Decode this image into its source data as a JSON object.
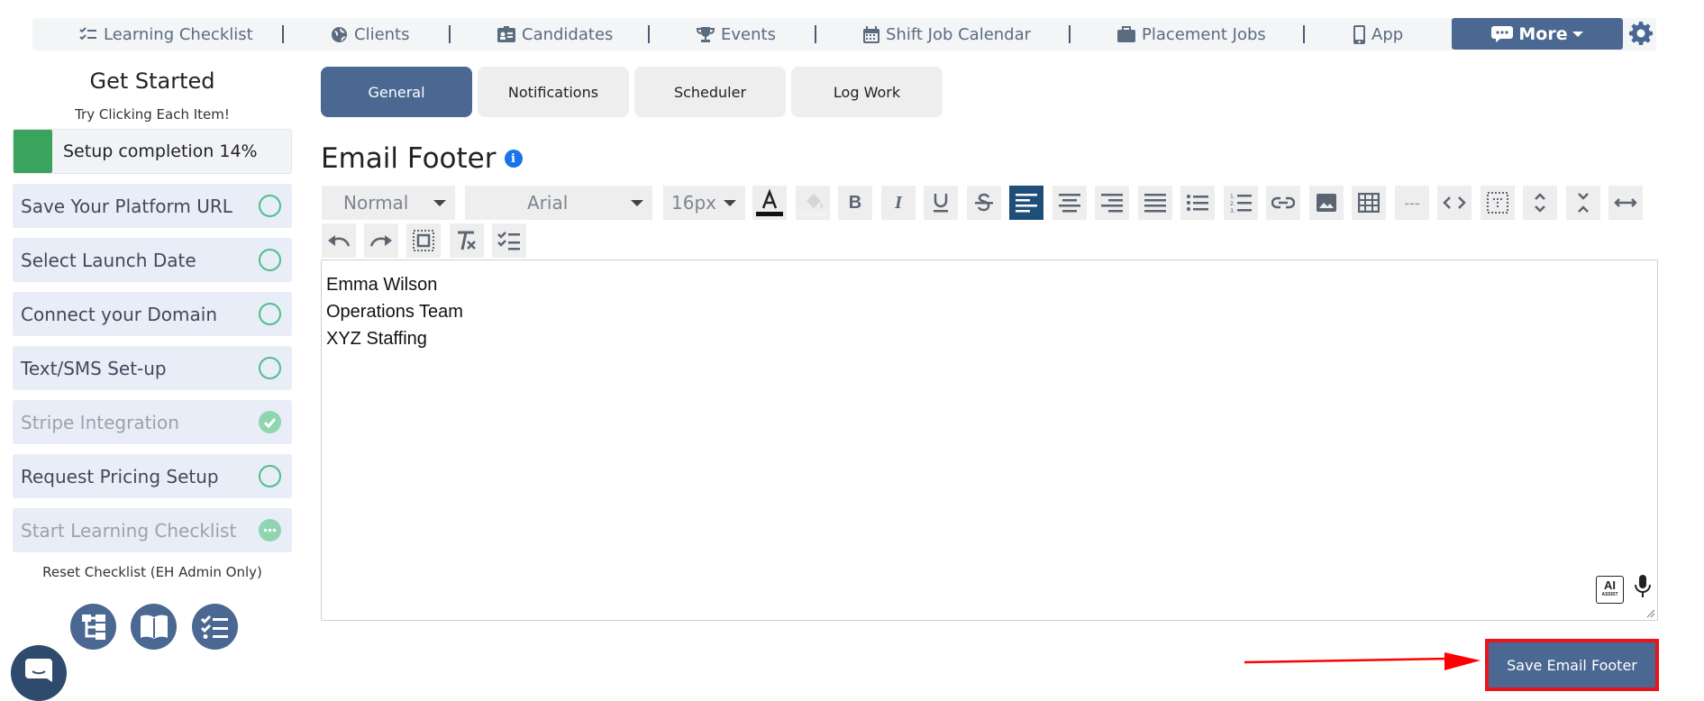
{
  "nav": {
    "items": [
      {
        "label": "Learning Checklist",
        "icon": "checklist-icon"
      },
      {
        "label": "Clients",
        "icon": "globe-icon"
      },
      {
        "label": "Candidates",
        "icon": "id-badge-icon"
      },
      {
        "label": "Events",
        "icon": "trophy-icon"
      },
      {
        "label": "Shift Job Calendar",
        "icon": "calendar-icon"
      },
      {
        "label": "Placement Jobs",
        "icon": "briefcase-icon"
      },
      {
        "label": "App",
        "icon": "phone-icon"
      }
    ],
    "more_label": "More",
    "accent": "#4a6891"
  },
  "sidebar": {
    "title": "Get Started",
    "subtitle": "Try Clicking Each Item!",
    "progress_label": "Setup completion 14%",
    "progress_percent": 14,
    "items": [
      {
        "label": "Save Your Platform URL",
        "status": "open"
      },
      {
        "label": "Select Launch Date",
        "status": "open"
      },
      {
        "label": "Connect your Domain",
        "status": "open"
      },
      {
        "label": "Text/SMS Set-up",
        "status": "open"
      },
      {
        "label": "Stripe Integration",
        "status": "done"
      },
      {
        "label": "Request Pricing Setup",
        "status": "open"
      },
      {
        "label": "Start Learning Checklist",
        "status": "in-progress"
      }
    ],
    "reset_label": "Reset Checklist (EH Admin Only)"
  },
  "tabs": [
    {
      "label": "General",
      "active": true
    },
    {
      "label": "Notifications",
      "active": false
    },
    {
      "label": "Scheduler",
      "active": false
    },
    {
      "label": "Log Work",
      "active": false
    }
  ],
  "section": {
    "title": "Email Footer"
  },
  "toolbar": {
    "block_format": "Normal",
    "font_family": "Arial",
    "font_size": "16px",
    "hr_label": "---",
    "ai_label": "AI",
    "ai_sub": "ASSIST"
  },
  "editor": {
    "lines": [
      "Emma Wilson",
      "Operations Team",
      "XYZ Staffing"
    ]
  },
  "save": {
    "label": "Save Email Footer"
  }
}
